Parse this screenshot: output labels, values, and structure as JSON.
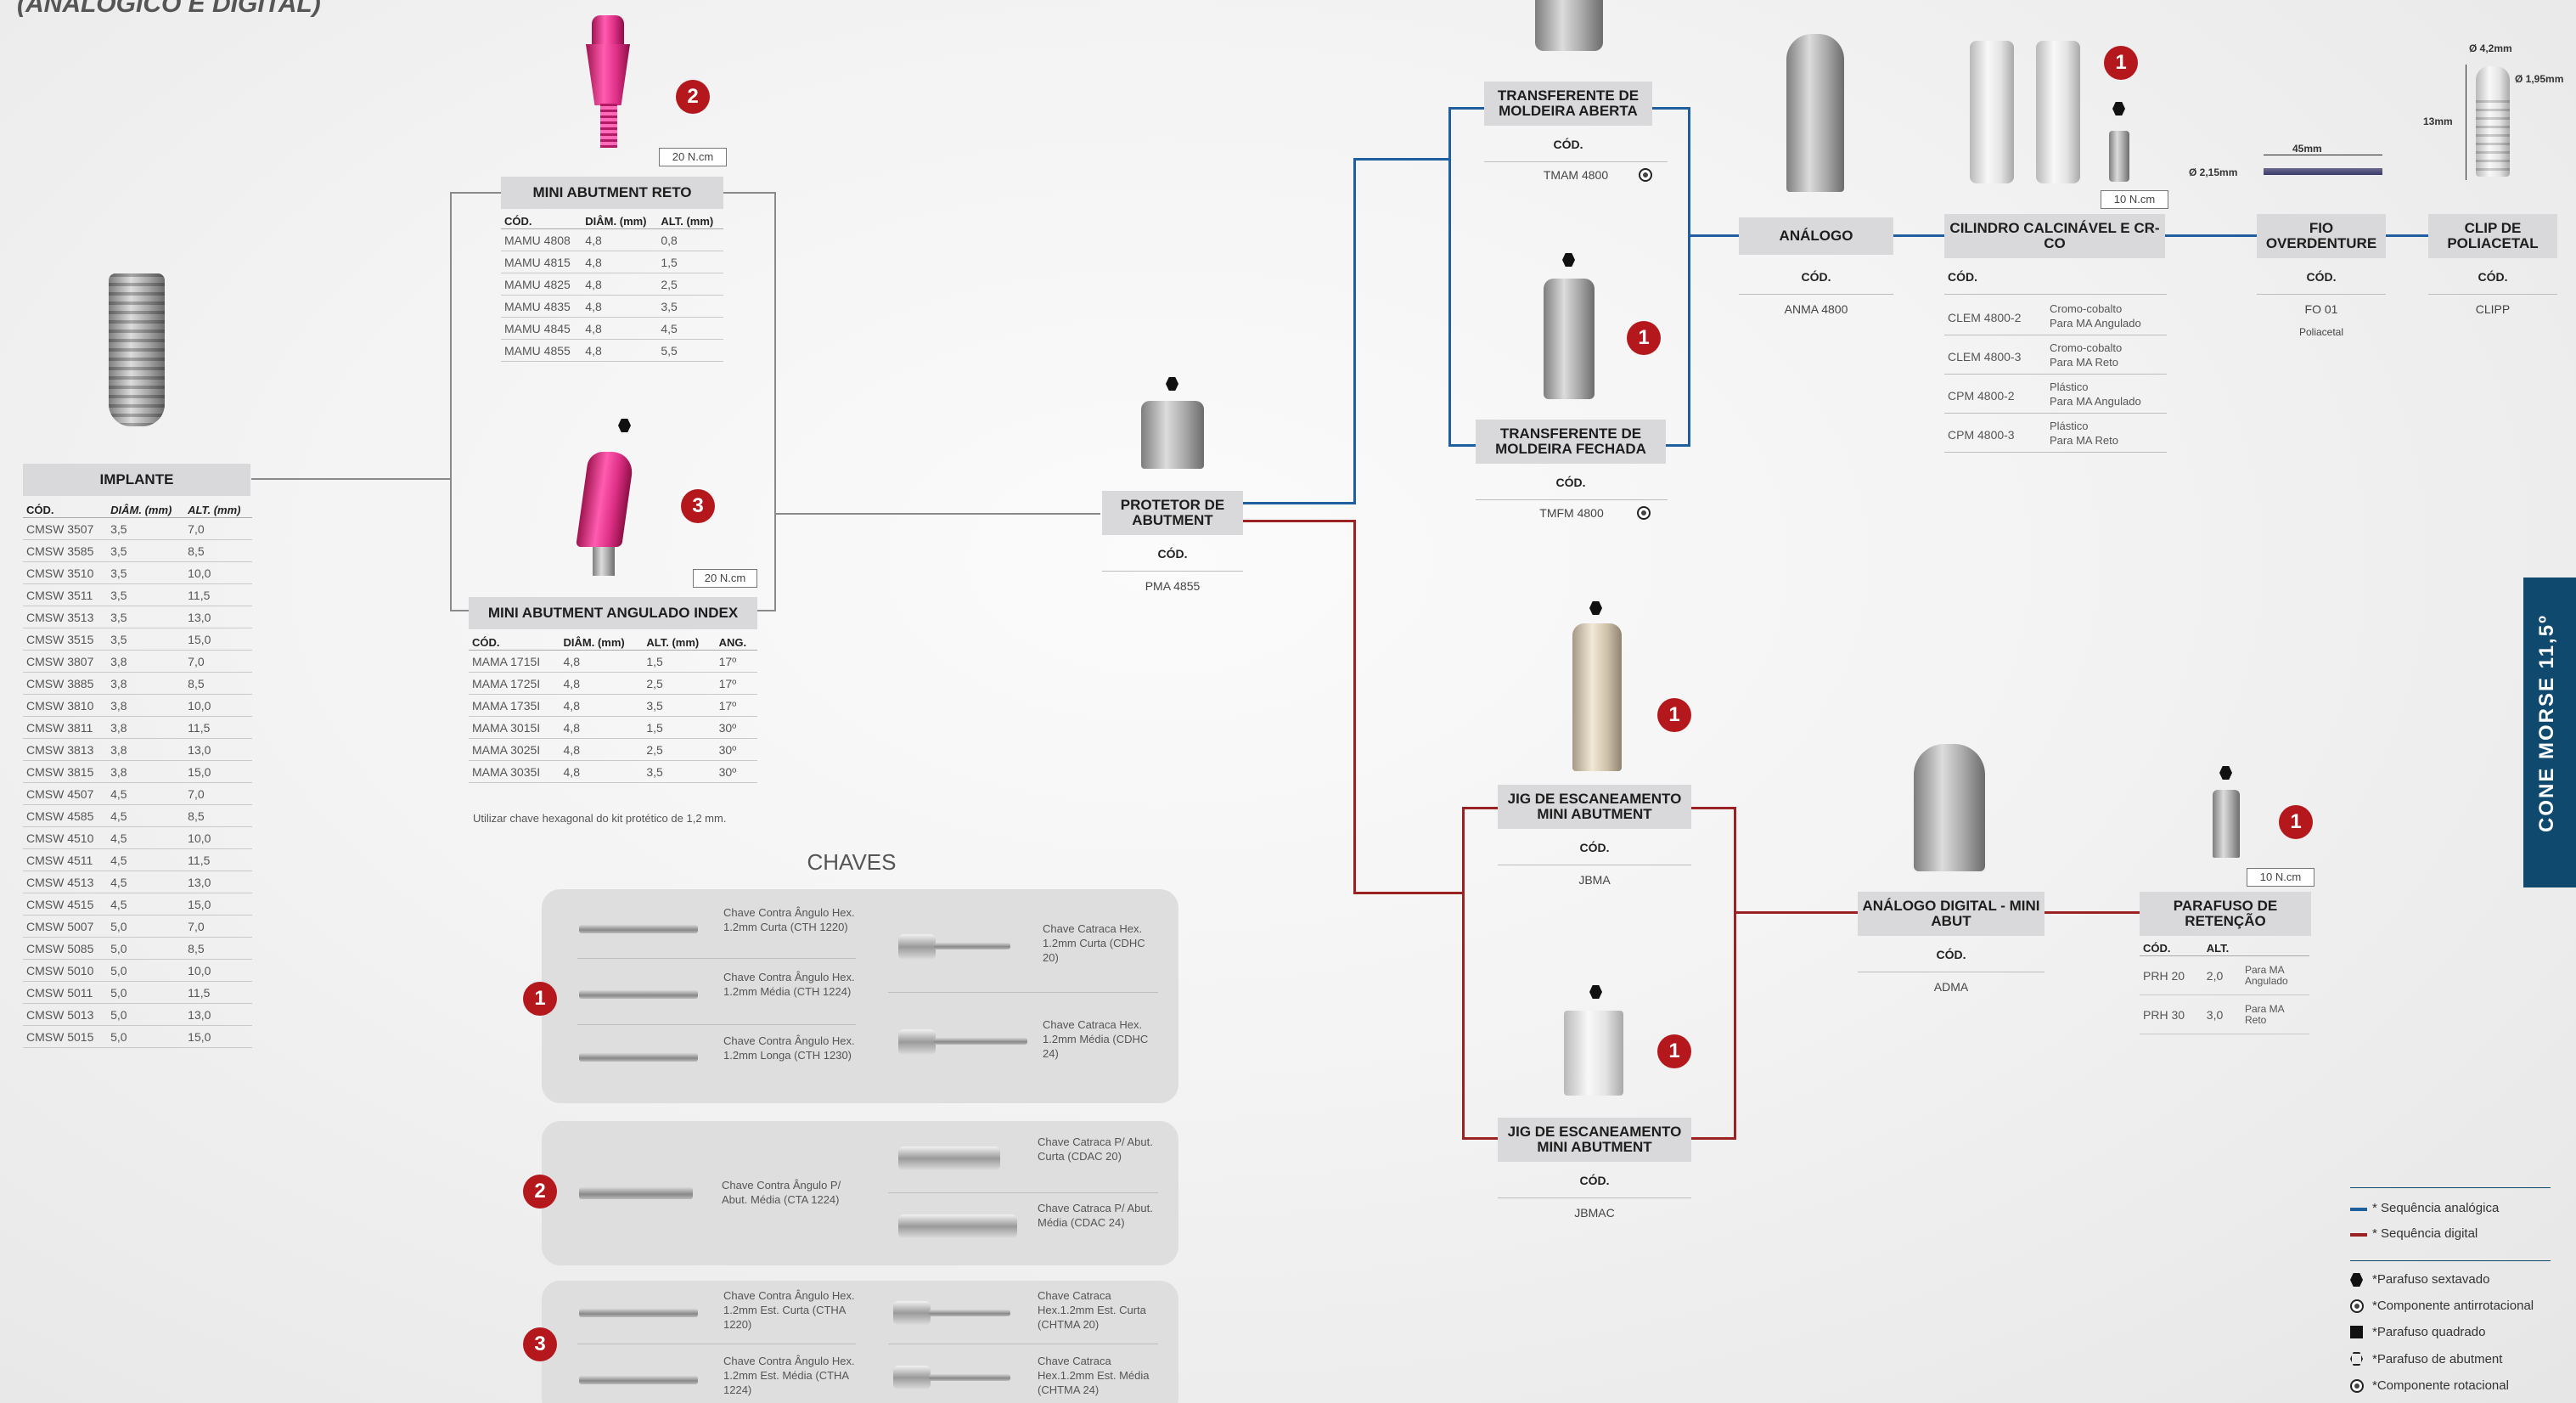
{
  "title": "(ANALÓGICO E DIGITAL)",
  "side_tab": "CONE MORSE 11,5º",
  "implante": {
    "title": "IMPLANTE",
    "headers": [
      "CÓD.",
      "DIÂM. (mm)",
      "ALT. (mm)"
    ],
    "rows": [
      [
        "CMSW 3507",
        "3,5",
        "7,0"
      ],
      [
        "CMSW 3585",
        "3,5",
        "8,5"
      ],
      [
        "CMSW 3510",
        "3,5",
        "10,0"
      ],
      [
        "CMSW 3511",
        "3,5",
        "11,5"
      ],
      [
        "CMSW 3513",
        "3,5",
        "13,0"
      ],
      [
        "CMSW 3515",
        "3,5",
        "15,0"
      ],
      [
        "CMSW 3807",
        "3,8",
        "7,0"
      ],
      [
        "CMSW 3885",
        "3,8",
        "8,5"
      ],
      [
        "CMSW 3810",
        "3,8",
        "10,0"
      ],
      [
        "CMSW 3811",
        "3,8",
        "11,5"
      ],
      [
        "CMSW 3813",
        "3,8",
        "13,0"
      ],
      [
        "CMSW 3815",
        "3,8",
        "15,0"
      ],
      [
        "CMSW 4507",
        "4,5",
        "7,0"
      ],
      [
        "CMSW 4585",
        "4,5",
        "8,5"
      ],
      [
        "CMSW 4510",
        "4,5",
        "10,0"
      ],
      [
        "CMSW 4511",
        "4,5",
        "11,5"
      ],
      [
        "CMSW 4513",
        "4,5",
        "13,0"
      ],
      [
        "CMSW 4515",
        "4,5",
        "15,0"
      ],
      [
        "CMSW 5007",
        "5,0",
        "7,0"
      ],
      [
        "CMSW 5085",
        "5,0",
        "8,5"
      ],
      [
        "CMSW 5010",
        "5,0",
        "10,0"
      ],
      [
        "CMSW 5011",
        "5,0",
        "11,5"
      ],
      [
        "CMSW 5013",
        "5,0",
        "13,0"
      ],
      [
        "CMSW 5015",
        "5,0",
        "15,0"
      ]
    ]
  },
  "mini_reto": {
    "title": "MINI ABUTMENT RETO",
    "torque": "20 N.cm",
    "badge": "2",
    "headers": [
      "CÓD.",
      "DIÂM. (mm)",
      "ALT. (mm)"
    ],
    "rows": [
      [
        "MAMU 4808",
        "4,8",
        "0,8"
      ],
      [
        "MAMU 4815",
        "4,8",
        "1,5"
      ],
      [
        "MAMU 4825",
        "4,8",
        "2,5"
      ],
      [
        "MAMU 4835",
        "4,8",
        "3,5"
      ],
      [
        "MAMU 4845",
        "4,8",
        "4,5"
      ],
      [
        "MAMU 4855",
        "4,8",
        "5,5"
      ]
    ]
  },
  "mini_ang": {
    "title": "MINI ABUTMENT ANGULADO INDEX",
    "torque": "20 N.cm",
    "badge": "3",
    "headers": [
      "CÓD.",
      "DIÂM. (mm)",
      "ALT. (mm)",
      "ANG."
    ],
    "rows": [
      [
        "MAMA 1715I",
        "4,8",
        "1,5",
        "17º"
      ],
      [
        "MAMA 1725I",
        "4,8",
        "2,5",
        "17º"
      ],
      [
        "MAMA 1735I",
        "4,8",
        "3,5",
        "17º"
      ],
      [
        "MAMA 3015I",
        "4,8",
        "1,5",
        "30º"
      ],
      [
        "MAMA 3025I",
        "4,8",
        "2,5",
        "30º"
      ],
      [
        "MAMA 3035I",
        "4,8",
        "3,5",
        "30º"
      ]
    ],
    "note": "Utilizar chave hexagonal do kit protético de 1,2 mm."
  },
  "protetor": {
    "title": "PROTETOR DE ABUTMENT",
    "cod_label": "CÓD.",
    "code": "PMA 4855"
  },
  "transf_aberta": {
    "title": "TRANSFERENTE DE MOLDEIRA ABERTA",
    "cod_label": "CÓD.",
    "code": "TMAM 4800"
  },
  "transf_fechada": {
    "title": "TRANSFERENTE DE MOLDEIRA FECHADA",
    "cod_label": "CÓD.",
    "code": "TMFM 4800",
    "badge": "1"
  },
  "analogo": {
    "title": "ANÁLOGO",
    "cod_label": "CÓD.",
    "code": "ANMA 4800"
  },
  "cilindro": {
    "title": "CILINDRO CALCINÁVEL E CR-CO",
    "cod_label": "CÓD.",
    "torque": "10 N.cm",
    "badge": "1",
    "rows": [
      [
        "CLEM 4800-2",
        "Cromo-cobalto",
        "Para MA Angulado"
      ],
      [
        "CLEM 4800-3",
        "Cromo-cobalto",
        "Para MA Reto"
      ],
      [
        "CPM 4800-2",
        "Plástico",
        "Para MA Angulado"
      ],
      [
        "CPM 4800-3",
        "Plástico",
        "Para MA Reto"
      ]
    ]
  },
  "fio": {
    "title": "FIO OVERDENTURE",
    "cod_label": "CÓD.",
    "code": "FO 01",
    "sub": "Poliacetal",
    "dim_len": "45mm",
    "dim_diam": "Ø 2,15mm"
  },
  "clip": {
    "title": "CLIP DE POLIACETAL",
    "cod_label": "CÓD.",
    "code": "CLIPP",
    "dim1": "Ø 4,2mm",
    "dim2": "Ø 1,95mm",
    "dim3": "13mm"
  },
  "jig1": {
    "title": "JIG DE ESCANEAMENTO MINI ABUTMENT",
    "cod_label": "CÓD.",
    "code": "JBMA",
    "badge": "1"
  },
  "jig2": {
    "title": "JIG DE ESCANEAMENTO MINI ABUTMENT",
    "cod_label": "CÓD.",
    "code": "JBMAC",
    "badge": "1"
  },
  "analogo_dig": {
    "title": "ANÁLOGO DIGITAL - MINI ABUT",
    "cod_label": "CÓD.",
    "code": "ADMA"
  },
  "parafuso": {
    "title": "PARAFUSO DE RETENÇÃO",
    "torque": "10 N.cm",
    "badge": "1",
    "headers": [
      "CÓD.",
      "ALT."
    ],
    "rows": [
      [
        "PRH 20",
        "2,0",
        "Para MA Angulado"
      ],
      [
        "PRH 30",
        "3,0",
        "Para MA Reto"
      ]
    ]
  },
  "chaves": {
    "title": "CHAVES",
    "g1": {
      "badge": "1",
      "left": [
        "Chave Contra Ângulo Hex. 1.2mm Curta (CTH 1220)",
        "Chave Contra Ângulo Hex. 1.2mm Média (CTH 1224)",
        "Chave Contra Ângulo Hex. 1.2mm Longa (CTH 1230)"
      ],
      "right": [
        "Chave Catraca Hex. 1.2mm Curta (CDHC 20)",
        "Chave Catraca Hex. 1.2mm Média (CDHC 24)"
      ]
    },
    "g2": {
      "badge": "2",
      "left": [
        "Chave Contra Ângulo P/ Abut. Média (CTA 1224)"
      ],
      "right": [
        "Chave Catraca P/ Abut. Curta (CDAC 20)",
        "Chave Catraca P/ Abut. Média (CDAC 24)"
      ]
    },
    "g3": {
      "badge": "3",
      "left": [
        "Chave Contra Ângulo Hex. 1.2mm Est. Curta (CTHA 1220)",
        "Chave Contra Ângulo Hex. 1.2mm Est. Média (CTHA 1224)"
      ],
      "right": [
        "Chave Catraca Hex.1.2mm Est. Curta (CHTMA 20)",
        "Chave Catraca Hex.1.2mm Est. Média (CHTMA 24)"
      ]
    }
  },
  "legend": {
    "analog": "* Sequência analógica",
    "digital": "* Sequência digital",
    "hex": "*Parafuso sextavado",
    "anti": "*Componente antirrotacional",
    "square": "*Parafuso quadrado",
    "abut": "*Parafuso de abutment",
    "rot": "*Componente rotacional"
  },
  "colors": {
    "analog": "#1f5fa0",
    "digital": "#9a2222",
    "badge": "#b4181d",
    "side": "#0f4a6e"
  }
}
